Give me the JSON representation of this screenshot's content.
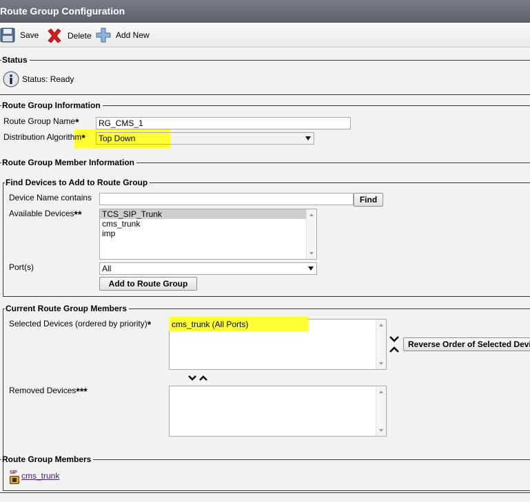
{
  "window": {
    "title": "Route Group Configuration"
  },
  "toolbar": {
    "save": "Save",
    "delete": "Delete",
    "add_new": "Add New"
  },
  "status": {
    "legend": "Status",
    "text": "Status: Ready"
  },
  "info": {
    "legend": "Route Group Information",
    "name_label": "Route Group Name",
    "name_value": "RG_CMS_1",
    "algo_label": "Distribution Algorithm",
    "algo_value": "Top Down",
    "required_mark": "*"
  },
  "member_info": {
    "legend": "Route Group Member Information"
  },
  "find": {
    "legend": "Find Devices to Add to Route Group",
    "device_name_label": "Device Name contains",
    "device_name_value": "",
    "find_button": "Find",
    "available_label": "Available Devices",
    "available_mark": "**",
    "available_devices": [
      "TCS_SIP_Trunk",
      "cms_trunk",
      "imp"
    ],
    "ports_label": "Port(s)",
    "ports_value": "All",
    "add_button": "Add to Route Group"
  },
  "current": {
    "legend": "Current Route Group Members",
    "selected_label": "Selected Devices (ordered by priority)",
    "selected_mark": "*",
    "selected_devices": [
      "cms_trunk (All Ports)"
    ],
    "reverse_button": "Reverse Order of Selected Devices",
    "removed_label": "Removed Devices",
    "removed_mark": "***"
  },
  "members": {
    "legend": "Route Group Members",
    "items": [
      {
        "badge": "SIP",
        "name": "cms_trunk"
      }
    ]
  },
  "colors": {
    "highlight": "#ffff33",
    "link": "#3a1f7a",
    "titlebar": "#5d6167"
  }
}
